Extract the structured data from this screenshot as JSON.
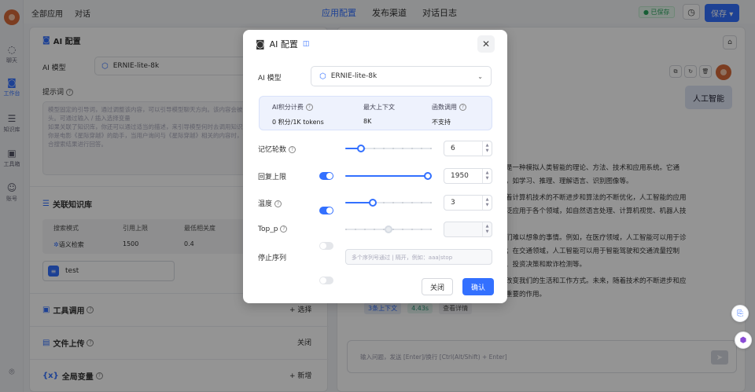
{
  "nav": {
    "items": [
      {
        "label": "聊天",
        "icon": "chat-icon"
      },
      {
        "label": "工作台",
        "icon": "robot-icon"
      },
      {
        "label": "知识库",
        "icon": "database-icon"
      },
      {
        "label": "工具箱",
        "icon": "toolbox-icon"
      },
      {
        "label": "账号",
        "icon": "user-icon"
      }
    ]
  },
  "topbar": {
    "breadcrumb_all": "全部应用",
    "breadcrumb_current": "对话",
    "tabs": [
      "应用配置",
      "发布渠道",
      "对话日志"
    ],
    "saved_badge": "已保存",
    "save_label": "保存"
  },
  "left": {
    "ai_config_title": "AI 配置",
    "ai_model_label": "AI 模型",
    "ai_model_value": "ERNIE-lite-8k",
    "prompt_label": "提示词",
    "prompt_lines": [
      "模型固定的引导词，通过调整该内容，可以引导模型聊天方向。该内容会被固定在上下文的开",
      "头。可通过输入 / 插入选择变量",
      "如果关联了知识库，你还可以通过适当的描述，来引导模型何时去调用知识库搜索。例如：",
      "你是电影《星际穿越》的助手，当用户询问与《星际穿越》相关的内容时，请搜索知识库并结",
      "合搜索结果进行回答。"
    ],
    "kb_title": "关联知识库",
    "kb_headers": [
      "搜索模式",
      "引用上限",
      "最低相关度"
    ],
    "kb_values": [
      "语义检索",
      "1500",
      "0.4"
    ],
    "kb_item": "test",
    "tools_title": "工具调用",
    "tools_action": "+ 选择",
    "upload_title": "文件上传",
    "upload_action": "关闭",
    "vars_title": "全局变量",
    "vars_action": "+ 新增"
  },
  "right": {
    "user_message": "人工智能",
    "answer_lines": [
      "是一种模拟人类智能的理论、方法、技术和应用系统。它通",
      "，如学习、推理、理解语言、识别图像等。",
      "着计算机技术的不断进步和算法的不断优化，人工智能的应用",
      "泛应用于各个领域，如自然语言处理、计算机视觉、机器人技",
      "",
      "们难以想象的事情。例如，在医疗领域，人工智能可以用于诊",
      "；在交通领域，人工智能可以用于智能驾驶和交通流量控制",
      "、投资决策和欺诈检测等。",
      "",
      "改变我们的生活和工作方式。未来，随着技术的不断进步和应",
      "重要的作用。"
    ],
    "tag_context": "3条上下文",
    "tag_time": "4.43s",
    "tag_details": "查看详情",
    "input_placeholder": "输入问题，发送 [Enter]/换行 [Ctrl(Alt/Shift) + Enter]"
  },
  "modal": {
    "title": "AI 配置",
    "model_label": "AI 模型",
    "model_value": "ERNIE-lite-8k",
    "info": {
      "h1": "AI积分计费",
      "v1": "0 积分/1K tokens",
      "h2": "最大上下文",
      "v2": "8K",
      "h3": "函数调用",
      "v3": "不支持"
    },
    "memory_label": "记忆轮数",
    "memory_value": "6",
    "memory_fraction": 0.15,
    "max_tokens_label": "回复上限",
    "max_tokens_value": "1950",
    "max_tokens_fraction": 1.0,
    "temperature_label": "温度",
    "temperature_value": "3",
    "temperature_fraction": 0.3,
    "top_p_label": "Top_p",
    "top_p_fraction": 0.5,
    "stop_label": "停止序列",
    "stop_placeholder": "多个序列号通过 | 隔开，例如：aaa|stop",
    "close_label": "关闭",
    "confirm_label": "确认"
  },
  "colors": {
    "accent": "#3370ff",
    "saved_green": "#27a35c",
    "avatar": "#d66a3a"
  }
}
